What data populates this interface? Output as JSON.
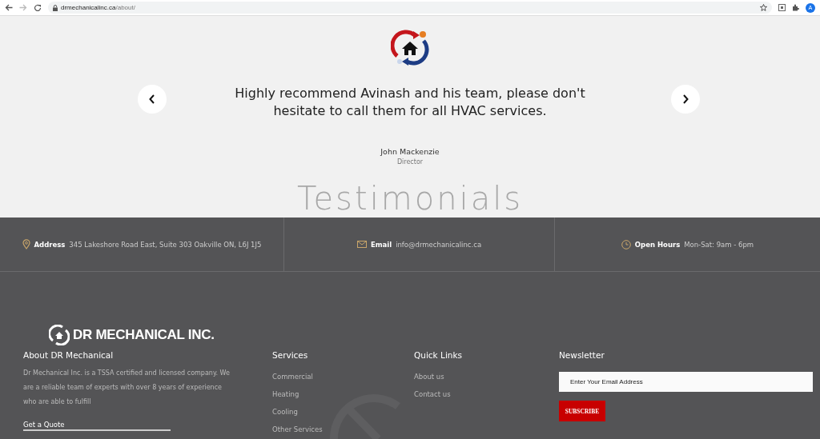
{
  "browser": {
    "url_host": "drmechanicalinc.ca",
    "url_path": "/about/",
    "back_disabled": false,
    "forward_disabled": true,
    "avatar": "A"
  },
  "testimonial": {
    "quote": "Highly recommend Avinash and his team, please don't hesitate to call them for all HVAC services.",
    "author": "John Mackenzie",
    "role": "Director",
    "backdrop": "Testimonials"
  },
  "info_bar": [
    {
      "kind": "address",
      "label": "Address",
      "value": "345 Lakeshore Road East, Suite 303 Oakville ON, L6J 1J5"
    },
    {
      "kind": "email",
      "label": "Email",
      "value": "info@drmechanicalinc.ca"
    },
    {
      "kind": "hours",
      "label": "Open Hours",
      "value": "Mon-Sat: 9am - 6pm"
    }
  ],
  "footer": {
    "brand": "DR MECHANICAL INC.",
    "about_title": "About DR Mechanical",
    "about_text": "Dr Mechanical Inc. is a TSSA certified and licensed company. We are a reliable team of experts with over 8 years of experience who are able to fulfill",
    "quote_link": "Get a Quote",
    "services_title": "Services",
    "services": [
      "Commercial",
      "Heating",
      "Cooling",
      "Other Services"
    ],
    "links_title": "Quick Links",
    "links": [
      "About us",
      "Contact us"
    ],
    "newsletter_title": "Newsletter",
    "email_placeholder": "Enter Your Email Address",
    "subscribe": "SUBSCRIBE"
  }
}
